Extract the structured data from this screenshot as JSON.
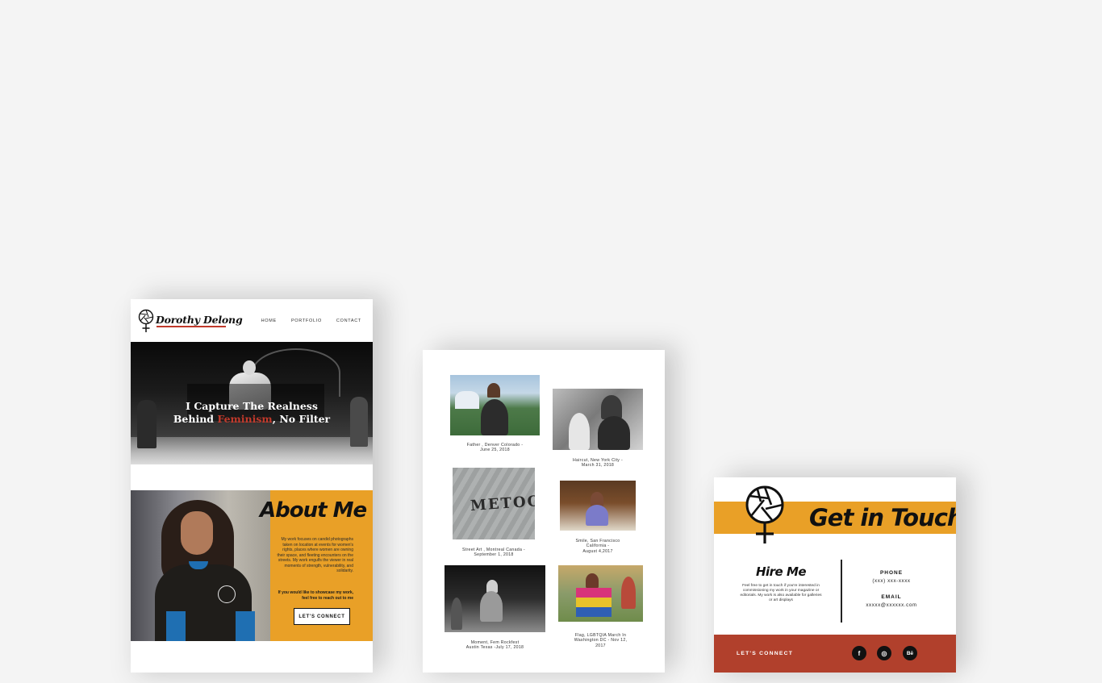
{
  "home": {
    "brand_name": "Dorothy Delong",
    "nav": [
      "HOME",
      "PORTFOLIO",
      "CONTACT"
    ],
    "hero_line1": "I Capture The Realness",
    "hero_line2_a": "Behind ",
    "hero_line2_accent": "Feminism",
    "hero_line2_b": ", No Filter",
    "about_heading": "About Me",
    "about_text": "My work focuses on candid photographs taken on location at events for women's rights, places where women are owning their space, and fleeting encounters on the streets. My work engulfs the viewer in real moments of strength, vulnerability, and solidarity.",
    "about_cta": "If you would like to showcase my work, feel free to reach out to me",
    "about_button": "LET'S CONNECT"
  },
  "portfolio": {
    "items": [
      {
        "caption": "Father , Denver Colorado -\nJune 25, 2018"
      },
      {
        "caption": "Haircut, New York City -\nMarch 31, 2018"
      },
      {
        "caption": "Street Art , Montreal Canada -\nSeptember 1, 2018"
      },
      {
        "caption": "Smile, San Francisco\nCalifornia -\nAugust 4,2017"
      },
      {
        "caption": "Moment, Fem Rockfest\nAustin Texas -July 17, 2018"
      },
      {
        "caption": "Flag, LGBTQIA March In\nWashington DC - Nov 12,\n2017"
      }
    ],
    "street_art_word": "METOO"
  },
  "contact": {
    "title": "Get in Touch",
    "hire_heading": "Hire Me",
    "hire_text": "Feel free to get in touch if you're interested in commissioning my work in your magazine or editorials. My work is also available for galleries or art displays",
    "phone_label": "PHONE",
    "phone_value": "(xxx) xxx-xxxx",
    "email_label": "EMAIL",
    "email_value": "xxxxx@xxxxxx.com",
    "footer_connect": "LET'S CONNECT",
    "social": [
      {
        "icon": "facebook-icon",
        "glyph": "f"
      },
      {
        "icon": "instagram-icon",
        "glyph": "◎"
      },
      {
        "icon": "behance-icon",
        "glyph": "Bē"
      }
    ]
  },
  "colors": {
    "accent_orange": "#e9a027",
    "accent_red": "#c0392b",
    "footer_red": "#b1402c",
    "background": "#f4f4f4"
  }
}
